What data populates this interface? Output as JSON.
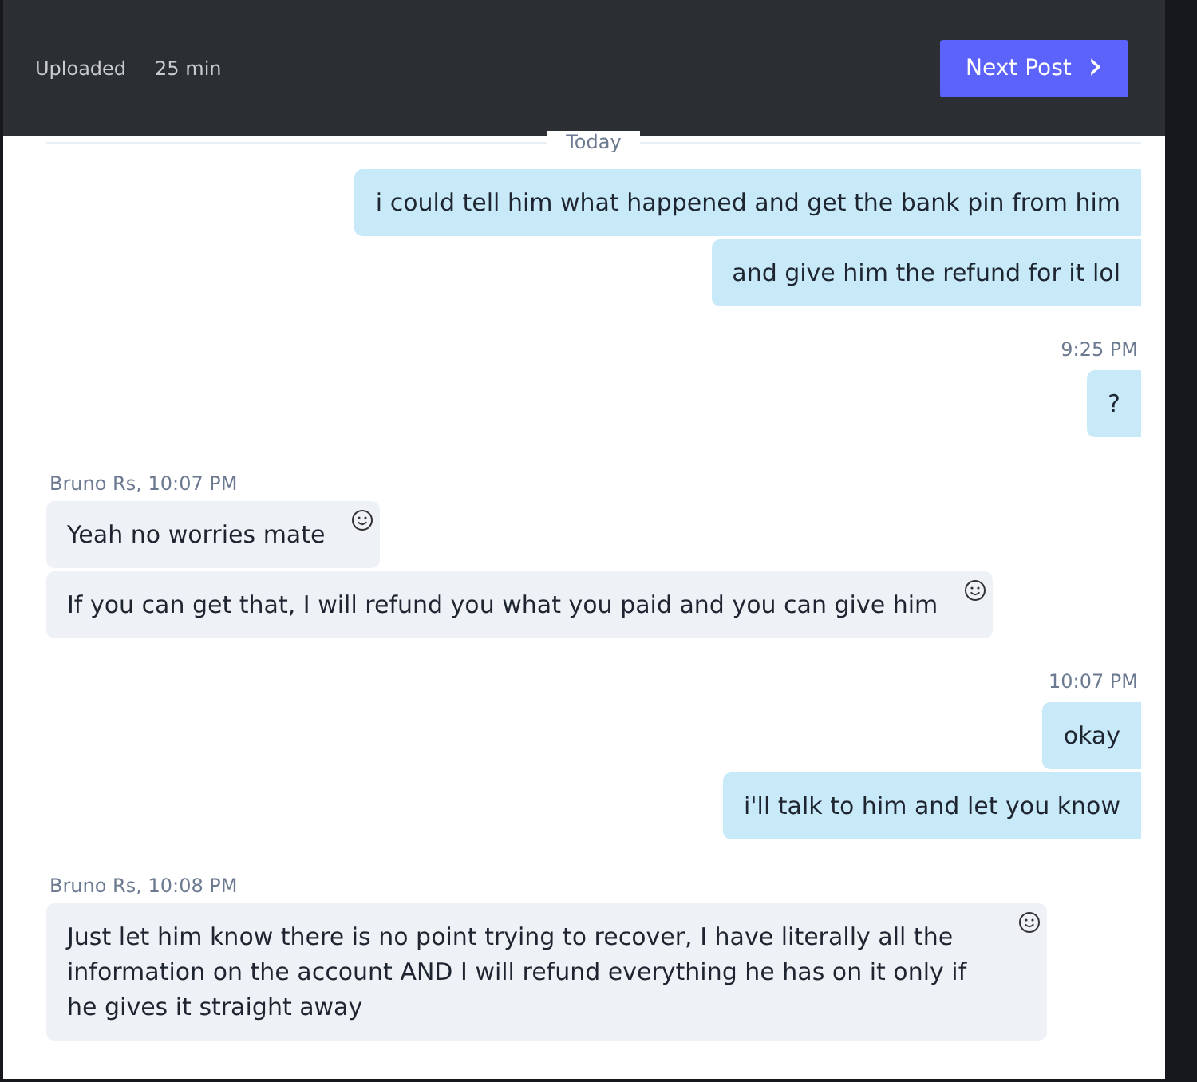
{
  "header": {
    "uploaded_label": "Uploaded",
    "uploaded_time": "25 min",
    "next_button": {
      "label": "Next Post",
      "icon": "›"
    }
  },
  "divider": "Today",
  "messages": [
    {
      "kind": "outgoing",
      "text": "i could tell him what happened and get the bank pin from him"
    },
    {
      "kind": "outgoing",
      "text": "and give him the refund for it lol"
    },
    {
      "kind": "time",
      "text": "9:25 PM"
    },
    {
      "kind": "outgoing",
      "text": "?"
    },
    {
      "kind": "sender",
      "text": "Bruno Rs,  10:07 PM"
    },
    {
      "kind": "incoming",
      "text": "Yeah no worries mate"
    },
    {
      "kind": "incoming",
      "text": "If you can get that, I will refund you what you paid and you can give him"
    },
    {
      "kind": "time",
      "text": "10:07 PM"
    },
    {
      "kind": "outgoing",
      "text": "okay"
    },
    {
      "kind": "outgoing",
      "text": "i'll talk to him and let you know"
    },
    {
      "kind": "sender",
      "text": "Bruno Rs,  10:08 PM"
    },
    {
      "kind": "incoming",
      "text": "Just let him know there is no point trying to recover, I have literally all the information on the account AND I will refund everything he has on it only if he gives it straight away"
    }
  ]
}
